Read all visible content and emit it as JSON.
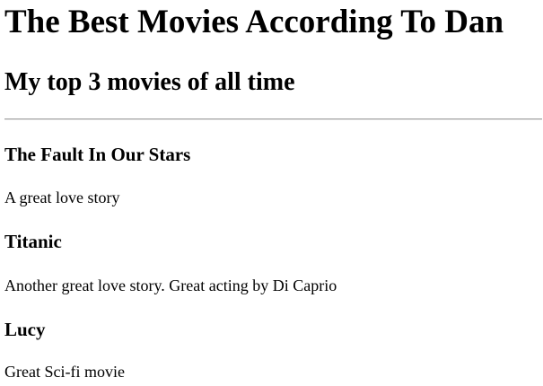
{
  "header": {
    "title": "The Best Movies According To Dan",
    "subtitle": "My top 3 movies of all time"
  },
  "movies": [
    {
      "title": "The Fault In Our Stars",
      "description": "A great love story"
    },
    {
      "title": "Titanic",
      "description": "Another great love story. Great acting by Di Caprio"
    },
    {
      "title": "Lucy",
      "description": "Great Sci-fi movie"
    }
  ]
}
